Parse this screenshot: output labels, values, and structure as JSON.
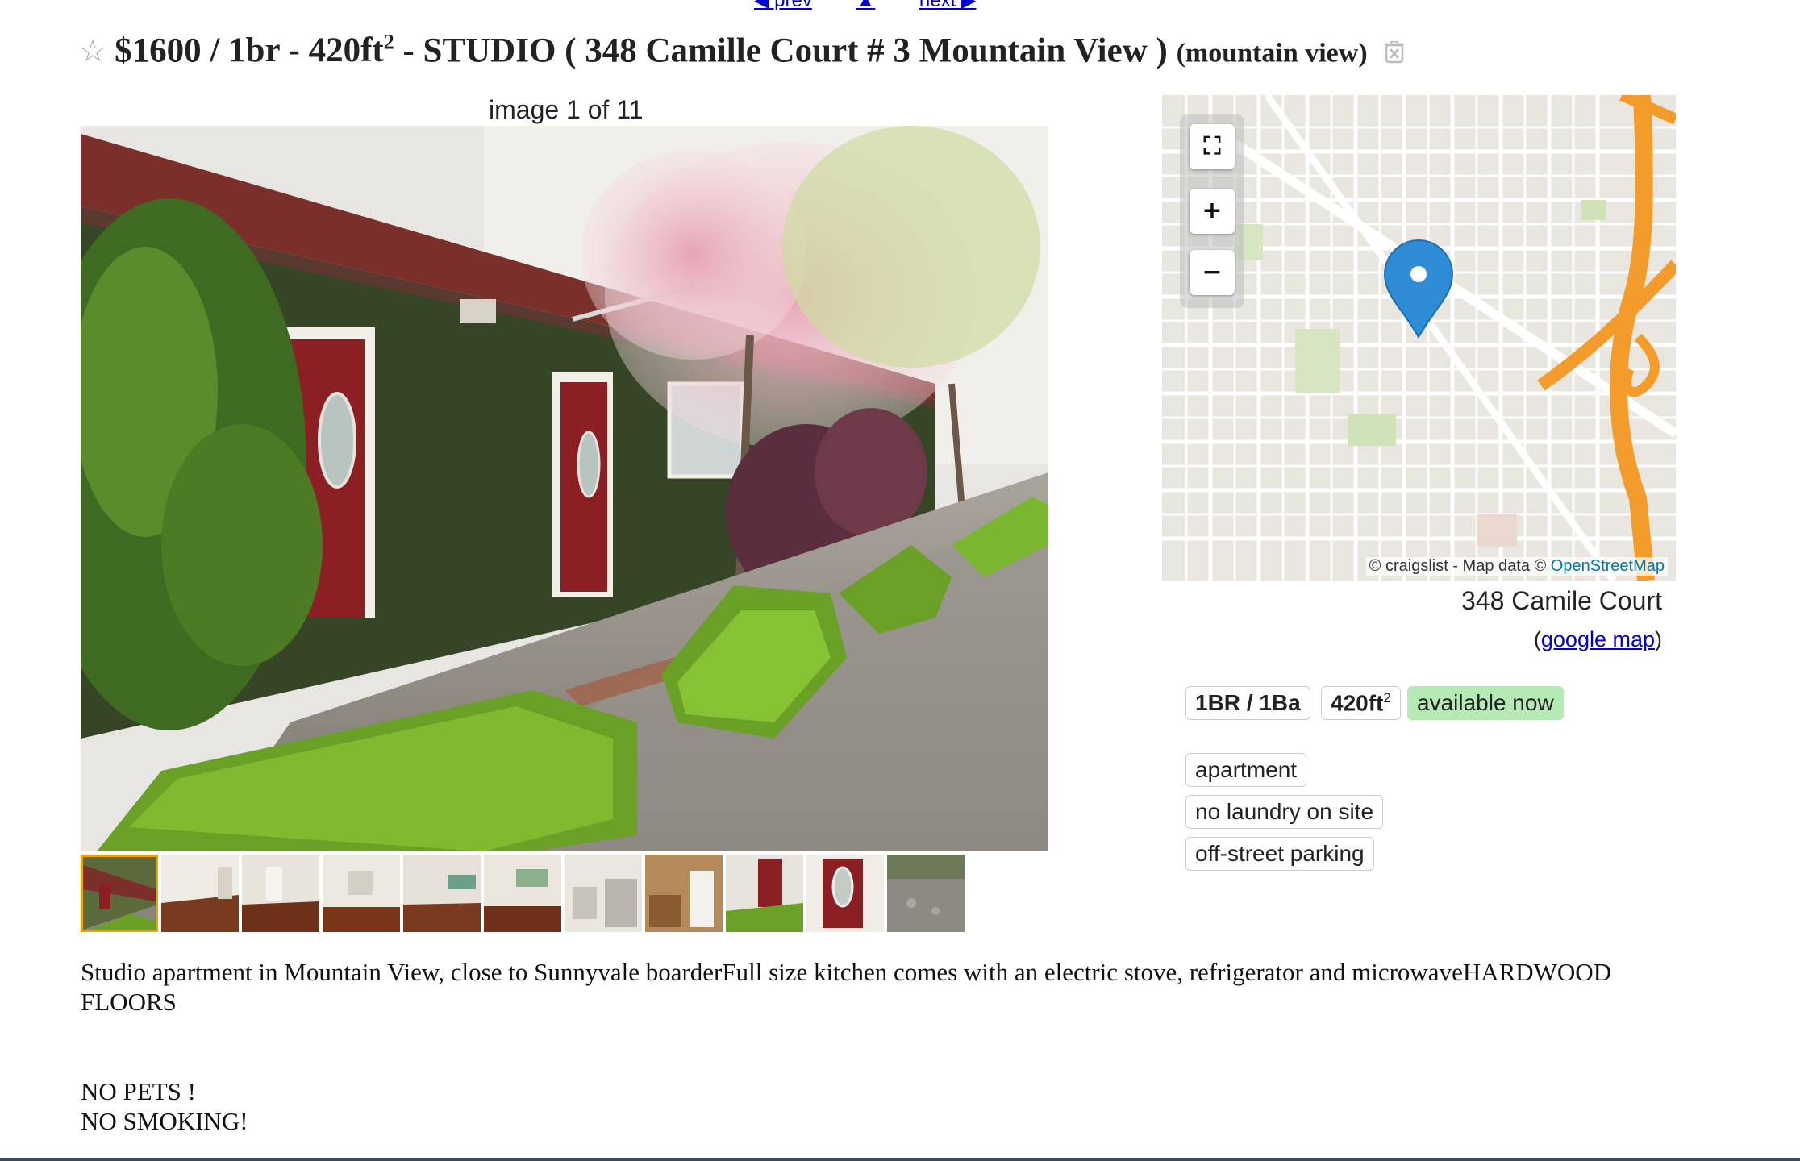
{
  "nav": {
    "prev": "◀ prev",
    "up": "▲",
    "next": "next ▶"
  },
  "title": {
    "price": "$1600",
    "housing_pre": "/ 1br - 420ft",
    "housing_sup": "2",
    "text": " - STUDIO ( 348 Camille Court # 3 Mountain View )",
    "hood": "(mountain view)"
  },
  "gallery": {
    "counter": "image 1 of 11",
    "thumb_count": 11
  },
  "map": {
    "attribution_prefix": "© craigslist - Map data © ",
    "attribution_link": "OpenStreetMap",
    "fullscreen": "⛶",
    "zoom_in": "+",
    "zoom_out": "−"
  },
  "address": "348 Camile Court",
  "google_map": {
    "open": "(",
    "link": "google map",
    "close": ")"
  },
  "attributes": {
    "br_ba": "1BR / 1Ba",
    "sqft": "420ft",
    "sqft_sup": "2",
    "availability": "available now",
    "housing_type": "apartment",
    "laundry": "no laundry on site",
    "parking": "off-street parking"
  },
  "description": {
    "line1": "Studio apartment in Mountain View, close to Sunnyvale boarderFull size kitchen comes with an electric stove, refrigerator and microwaveHARDWOOD FLOORS",
    "line2": "NO PETS !",
    "line3": "NO SMOKING!"
  },
  "colors": {
    "link": "#0000cc",
    "available_bg": "#b6eab4",
    "highway": "#f39c2b",
    "pin": "#2e8bd6"
  }
}
